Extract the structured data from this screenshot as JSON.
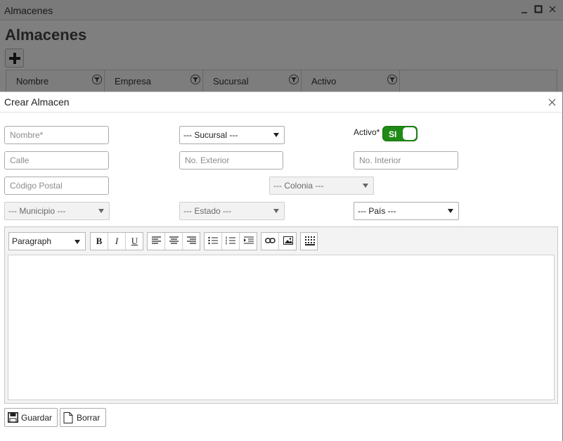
{
  "window": {
    "title": "Almacenes",
    "min_icon": "minimize-icon",
    "max_icon": "maximize-icon",
    "close_icon": "close-icon"
  },
  "page": {
    "heading": "Almacenes",
    "add_icon": "plus-icon"
  },
  "grid": {
    "columns": [
      "Nombre",
      "Empresa",
      "Sucursal",
      "Activo"
    ]
  },
  "dialog": {
    "title": "Crear Almacen",
    "fields": {
      "nombre_placeholder": "Nombre*",
      "sucursal_value": "--- Sucursal ---",
      "activo_label": "Activo*",
      "activo_toggle": "SI",
      "calle_placeholder": "Calle",
      "exterior_placeholder": "No. Exterior",
      "interior_placeholder": "No. Interior",
      "cp_placeholder": "Código Postal",
      "colonia_value": "--- Colonia ---",
      "municipio_value": "--- Municipio ---",
      "estado_value": "--- Estado ---",
      "pais_value": "--- País ---"
    },
    "editor": {
      "format_value": "Paragraph",
      "bold": "B",
      "italic": "I",
      "underline": "U"
    },
    "buttons": {
      "save": "Guardar",
      "clear": "Borrar"
    }
  }
}
